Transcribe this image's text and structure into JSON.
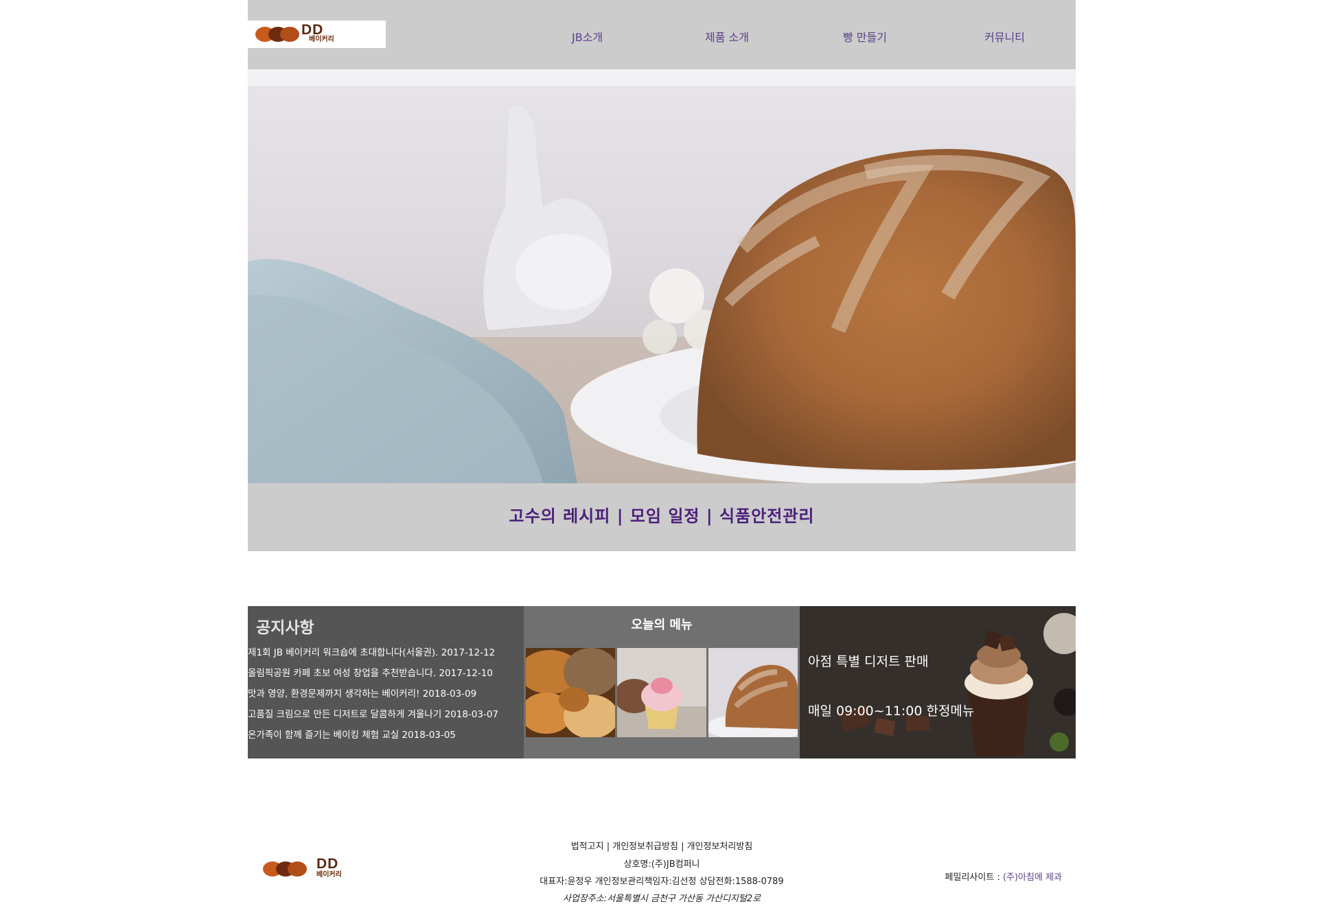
{
  "brand": {
    "logo_text": "DD",
    "logo_sub": "베이커리"
  },
  "nav": [
    {
      "label": "JB소개"
    },
    {
      "label": "제품 소개"
    },
    {
      "label": "빵 만들기"
    },
    {
      "label": "커뮤니티"
    }
  ],
  "band": {
    "items": [
      "고수의 레시피",
      "모임 일정",
      "식품안전관리"
    ],
    "separator": " | "
  },
  "notice": {
    "title": "공지사항",
    "items": [
      "제1회 JB 베이커리 워크숍에 초대합니다(서울권). 2017-12-12",
      "올림픽공원 카페 초보 여성 창업을 추천받습니다. 2017-12-10",
      "맛과 영양, 환경문제까지 생각하는 베이커리! 2018-03-09",
      "고품질 크림으로 만든 디저트로 달콤하게 겨울나기 2018-03-07",
      "온가족이 함께 즐기는 베이킹 체험 교실 2018-03-05"
    ]
  },
  "menu": {
    "title": "오늘의 메뉴",
    "images": [
      "bread-assortment",
      "cupcake",
      "bundt-cake"
    ]
  },
  "promo": {
    "line1": "아점 특별 디저트 판매",
    "line2": "매일 09:00~11:00 한정메뉴"
  },
  "footer": {
    "links": [
      "법적고지",
      "개인정보취급방침",
      "개인정보처리방침"
    ],
    "company": "상호명:(주)JB컴퍼니",
    "contact": "대표자:윤정우 개인정보관리책임자:김선정 상담전화:1588-0789",
    "address": "사업장주소:서울특별시 금천구 가산동 가산디지털2로",
    "family_label": "페밀리사이트 : ",
    "family_link": "(주)아침에 제과"
  },
  "colors": {
    "header_bg": "#cccccc",
    "nav_text": "#5a3e8a",
    "band_text": "#4b1e7a",
    "notice_bg": "#555555",
    "menu_bg": "#707070"
  }
}
